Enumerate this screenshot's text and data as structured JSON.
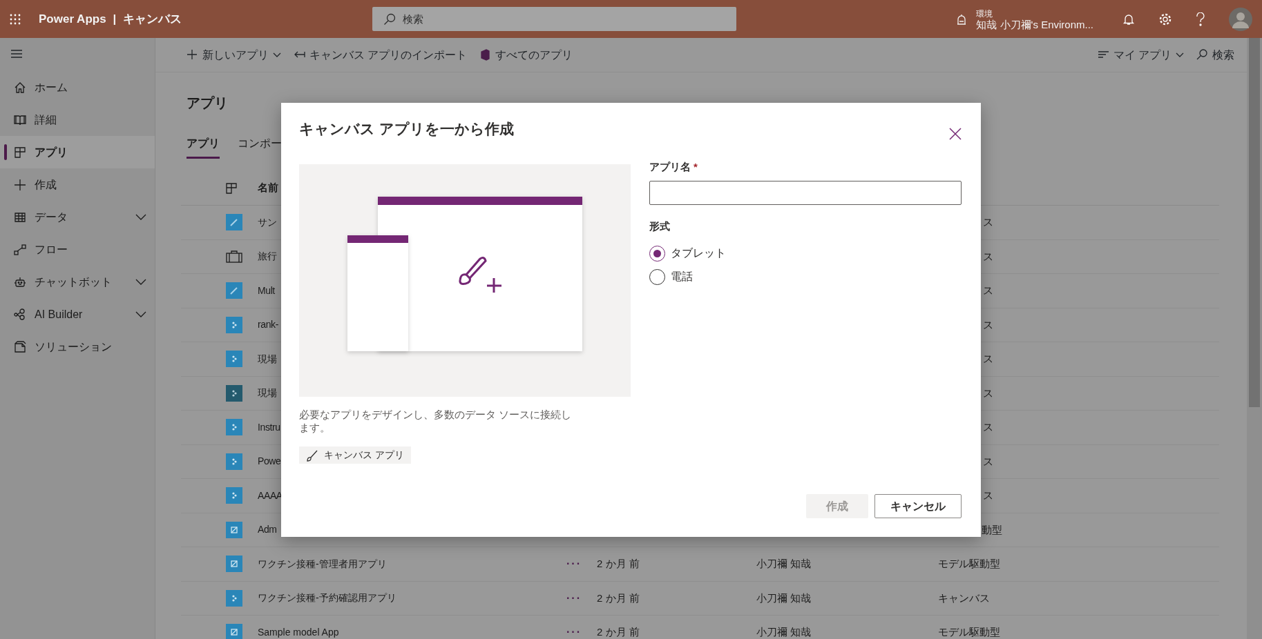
{
  "app_bar": {
    "product": "Power Apps",
    "separator": "|",
    "section": "キャンバス",
    "search": {
      "placeholder": "検索"
    },
    "environment": {
      "label": "環境",
      "name": "知哉 小刀禰's Environm..."
    }
  },
  "sidebar": {
    "items": [
      {
        "label": "ホーム",
        "kind": "home",
        "selected": false,
        "expandable": false
      },
      {
        "label": "詳細",
        "kind": "book",
        "selected": false,
        "expandable": false
      },
      {
        "label": "アプリ",
        "kind": "apps",
        "selected": true,
        "expandable": false
      },
      {
        "label": "作成",
        "kind": "plus",
        "selected": false,
        "expandable": false
      },
      {
        "label": "データ",
        "kind": "table",
        "selected": false,
        "expandable": true
      },
      {
        "label": "フロー",
        "kind": "flow",
        "selected": false,
        "expandable": false
      },
      {
        "label": "チャットボット",
        "kind": "bot",
        "selected": false,
        "expandable": true
      },
      {
        "label": "AI Builder",
        "kind": "ai",
        "selected": false,
        "expandable": true
      },
      {
        "label": "ソリューション",
        "kind": "solution",
        "selected": false,
        "expandable": false
      }
    ]
  },
  "command_bar": {
    "left": [
      {
        "label": "新しいアプリ",
        "kind": "new"
      },
      {
        "label": "キャンバス アプリのインポート",
        "kind": "import"
      },
      {
        "label": "すべてのアプリ",
        "kind": "office"
      }
    ],
    "right": [
      {
        "label": "マイ アプリ",
        "kind": "filter"
      },
      {
        "label": "検索",
        "kind": "search"
      }
    ]
  },
  "page": {
    "title": "アプリ",
    "tabs": [
      {
        "label": "アプリ",
        "selected": true
      },
      {
        "label": "コンポー",
        "selected": false
      }
    ]
  },
  "table": {
    "columns": [
      "名前"
    ],
    "rows": [
      {
        "kind": "pencil",
        "name": "サン",
        "type": "ス"
      },
      {
        "kind": "suitcase",
        "name": "旅行",
        "type": "ス"
      },
      {
        "kind": "pencil",
        "name": "Mult",
        "type": "ス"
      },
      {
        "kind": "canvas",
        "name": "rank-",
        "type": "ス"
      },
      {
        "kind": "canvas",
        "name": "現場",
        "type": "ス"
      },
      {
        "kind": "canvas-dark",
        "name": "現場",
        "type": "ス"
      },
      {
        "kind": "canvas",
        "name": "Instru",
        "type": "ス"
      },
      {
        "kind": "canvas",
        "name": "Powe",
        "type": "ス"
      },
      {
        "kind": "canvas",
        "name": "AAAA",
        "type": "ス"
      },
      {
        "kind": "model",
        "name": "Adm",
        "type": "動型"
      },
      {
        "kind": "model",
        "name": "ワクチン接種-管理者用アプリ",
        "more": "···",
        "modified": "2 か月 前",
        "owner": "小刀禰 知哉",
        "type": "モデル駆動型"
      },
      {
        "kind": "canvas",
        "name": "ワクチン接種-予約確認用アプリ",
        "more": "···",
        "modified": "2 か月 前",
        "owner": "小刀禰 知哉",
        "type": "キャンバス"
      },
      {
        "kind": "model",
        "name": "Sample model App",
        "more": "···",
        "modified": "2 か月 前",
        "owner": "小刀禰 知哉",
        "type": "モデル駆動型"
      }
    ]
  },
  "dialog": {
    "title": "キャンバス アプリを一から作成",
    "description": "必要なアプリをデザインし、多数のデータ ソースに接続します。",
    "tag": "キャンバス アプリ",
    "app_name": {
      "label": "アプリ名",
      "required": true,
      "required_mark": "*"
    },
    "format": {
      "label": "形式",
      "options": [
        {
          "label": "タブレット",
          "selected": true
        },
        {
          "label": "電話",
          "selected": false
        }
      ]
    },
    "buttons": [
      {
        "label": "作成",
        "kind": "primary",
        "disabled": true
      },
      {
        "label": "キャンセル",
        "kind": "default",
        "disabled": false
      }
    ]
  }
}
